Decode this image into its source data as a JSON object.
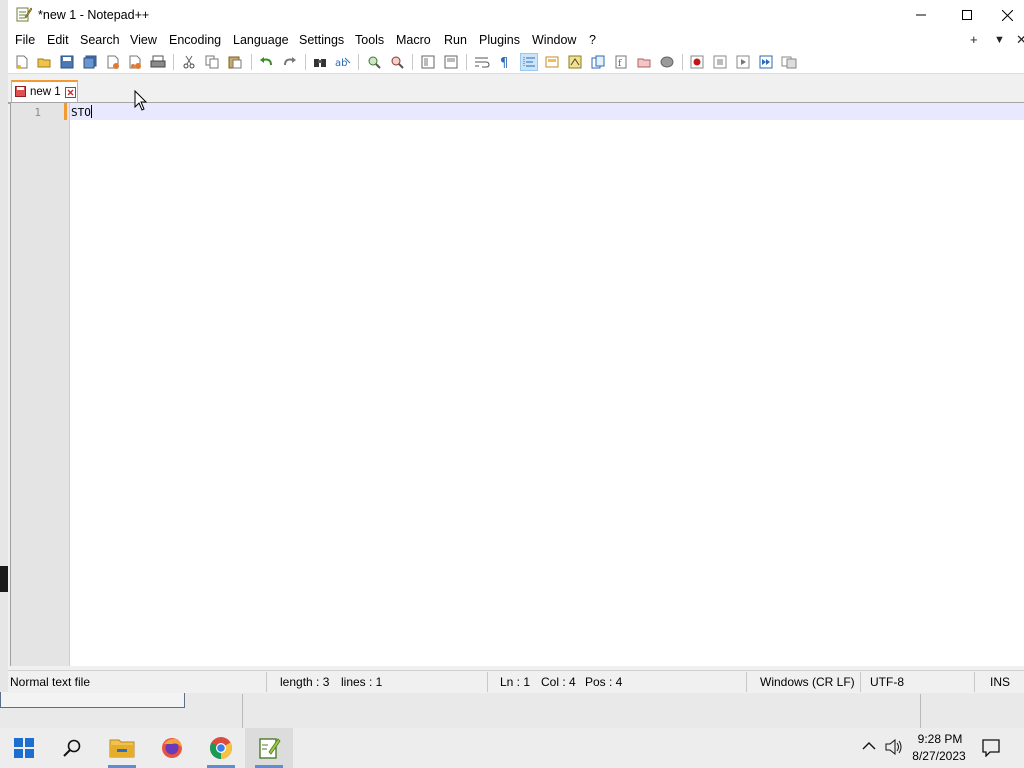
{
  "window": {
    "title": "*new 1 - Notepad++"
  },
  "menu": {
    "items": [
      "File",
      "Edit",
      "Search",
      "View",
      "Encoding",
      "Language",
      "Settings",
      "Tools",
      "Macro",
      "Run",
      "Plugins",
      "Window",
      "?"
    ],
    "right": {
      "plus": "+",
      "dropdown": "▼",
      "close": "✕"
    }
  },
  "toolbar": {
    "icons": [
      "new-file-icon",
      "open-file-icon",
      "save-icon",
      "save-all-icon",
      "close-icon",
      "close-all-icon",
      "print-icon",
      "cut-icon",
      "copy-icon",
      "paste-icon",
      "undo-icon",
      "redo-icon",
      "find-icon",
      "replace-icon",
      "zoom-in-icon",
      "zoom-out-icon",
      "sync-vertical-icon",
      "sync-horizontal-icon",
      "word-wrap-icon",
      "show-all-chars-icon",
      "indent-guide-icon",
      "udl-icon",
      "doc-map-icon",
      "function-list-icon",
      "folder-workspace-icon",
      "monitoring-icon",
      "record-macro-icon",
      "stop-macro-icon",
      "play-macro-icon",
      "run-macro-multiple-icon",
      "save-macro-icon"
    ]
  },
  "tab": {
    "label": "new 1"
  },
  "editor": {
    "line_number": "1",
    "text": "STO"
  },
  "status": {
    "file_type": "Normal text file",
    "length": "length : 3",
    "lines": "lines : 1",
    "ln": "Ln : 1",
    "col": "Col : 4",
    "pos": "Pos : 4",
    "eol": "Windows (CR LF)",
    "encoding": "UTF-8",
    "mode": "INS"
  },
  "taskbar": {
    "time": "9:28 PM",
    "date": "8/27/2023",
    "apps": [
      "start-icon",
      "search-icon",
      "file-explorer-icon",
      "firefox-icon",
      "chrome-icon",
      "notepad-plus-plus-icon"
    ]
  },
  "colors": {
    "accent_tab": "#f29b33",
    "current_line": "#e8e8ff",
    "taskbar_active": "#5a8fd6"
  }
}
